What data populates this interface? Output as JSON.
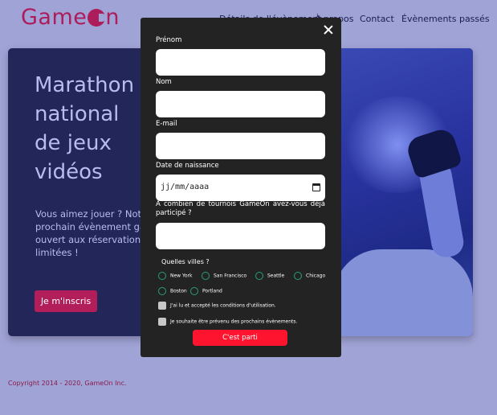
{
  "header": {
    "logo_text": "GameOn",
    "logo_main": "Game",
    "logo_tail": "n",
    "nav": [
      "Détails de l'évènement",
      "À propos",
      "Contact",
      "Évènements passés"
    ]
  },
  "hero": {
    "title_lines": [
      "Marathon",
      "national",
      "de jeux",
      "vidéos"
    ],
    "text_lines": [
      "Vous aimez jouer ? Notre",
      "prochain évènement gam",
      "ouvert aux réservations...",
      "limitées !"
    ],
    "signup_label": "Je m'inscris"
  },
  "footer": {
    "copyright": "Copyright 2014 - 2020, GameOn Inc."
  },
  "modal": {
    "first_name_label": "Prénom",
    "last_name_label": "Nom",
    "email_label": "E-mail",
    "birthdate_label": "Date de naissance",
    "birthdate_placeholder": "jj/mm/aaaa",
    "tournaments_label": "À combien de tournois GameOn avez-vous déjà participé ?",
    "cities_label": "Quelles villes ?",
    "cities": [
      "New York",
      "San Francisco",
      "Seattle",
      "Chicago",
      "Boston",
      "Portland"
    ],
    "terms_label": "J'ai lu et accepté les conditions d'utilisation.",
    "newsletter_label": "Je souhaite être prévenu des prochains évènements.",
    "submit_label": "C'est parti"
  },
  "colors": {
    "brand": "#ad1d5c",
    "modal_bg": "#232323",
    "submit": "#fe142f",
    "radio_border": "#279e7a",
    "page_bg": "#a0a3d6"
  }
}
